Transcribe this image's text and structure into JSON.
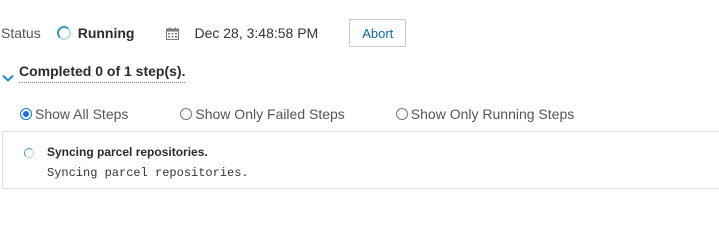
{
  "status": {
    "label": "Status",
    "value": "Running",
    "date": "Dec 28, 3:48:58 PM",
    "abort_label": "Abort",
    "icons": {
      "spinner": "spinner-icon",
      "calendar": "calendar-icon"
    }
  },
  "progress": {
    "summary": "Completed 0 of 1 step(s).",
    "chevron_icon": "chevron-down-icon"
  },
  "filters": {
    "options": [
      {
        "label": "Show All Steps",
        "checked": true
      },
      {
        "label": "Show Only Failed Steps",
        "checked": false
      },
      {
        "label": "Show Only Running Steps",
        "checked": false
      }
    ]
  },
  "steps": [
    {
      "title": "Syncing parcel repositories.",
      "detail": "Syncing parcel repositories.",
      "state": "running"
    }
  ],
  "colors": {
    "accent": "#1a73d6",
    "link": "#0b6aa2",
    "spinner": "#3a9bb5"
  }
}
